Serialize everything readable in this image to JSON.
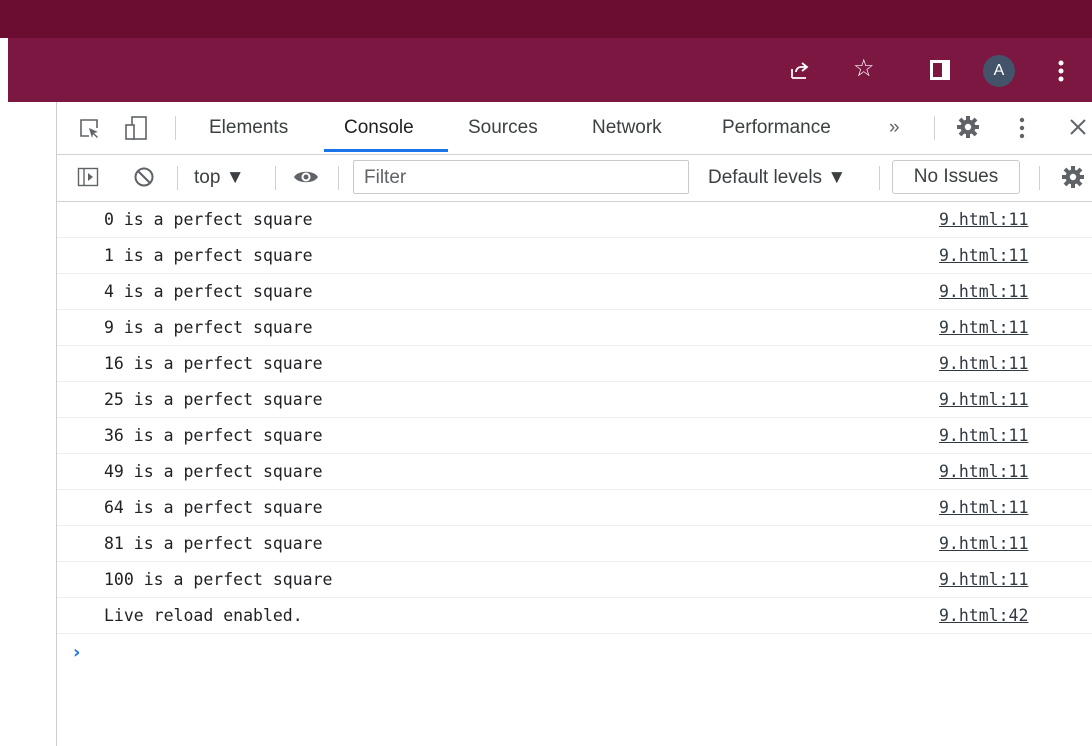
{
  "browser": {
    "avatar_initial": "A",
    "icons": [
      "share-icon",
      "star-icon",
      "side-panel-icon",
      "menu-dots-icon"
    ],
    "accent_color": "#7c1742"
  },
  "devtools": {
    "tabs": [
      {
        "label": "Elements",
        "active": false
      },
      {
        "label": "Console",
        "active": true
      },
      {
        "label": "Sources",
        "active": false
      },
      {
        "label": "Network",
        "active": false
      },
      {
        "label": "Performance",
        "active": false
      }
    ],
    "more_tabs_label": "»",
    "toolbar": {
      "context": "top ▼",
      "filter_placeholder": "Filter",
      "levels": "Default levels ▼",
      "issues": "No Issues"
    },
    "messages": [
      {
        "text": "0 is a perfect square",
        "source": "9.html:11"
      },
      {
        "text": "1 is a perfect square",
        "source": "9.html:11"
      },
      {
        "text": "4 is a perfect square",
        "source": "9.html:11"
      },
      {
        "text": "9 is a perfect square",
        "source": "9.html:11"
      },
      {
        "text": "16 is a perfect square",
        "source": "9.html:11"
      },
      {
        "text": "25 is a perfect square",
        "source": "9.html:11"
      },
      {
        "text": "36 is a perfect square",
        "source": "9.html:11"
      },
      {
        "text": "49 is a perfect square",
        "source": "9.html:11"
      },
      {
        "text": "64 is a perfect square",
        "source": "9.html:11"
      },
      {
        "text": "81 is a perfect square",
        "source": "9.html:11"
      },
      {
        "text": "100 is a perfect square",
        "source": "9.html:11"
      },
      {
        "text": "Live reload enabled.",
        "source": "9.html:42"
      }
    ],
    "prompt_glyph": "›"
  }
}
